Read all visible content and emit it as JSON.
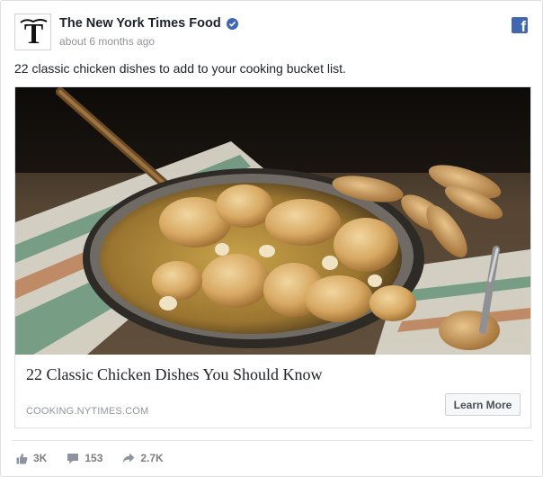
{
  "post": {
    "page_name": "The New York Times Food",
    "timestamp": "about 6 months ago",
    "text": "22 classic chicken dishes to add to your cooking bucket list."
  },
  "avatar": {
    "letter": "T"
  },
  "brand": {
    "fb_letter": "f",
    "accent": "#4267b2"
  },
  "link": {
    "title": "22 Classic Chicken Dishes You Should Know",
    "domain": "COOKING.NYTIMES.COM",
    "cta": "Learn More"
  },
  "stats": {
    "likes": "3K",
    "comments": "153",
    "shares": "2.7K"
  },
  "icons": [
    "verified-icon",
    "facebook-icon",
    "like-icon",
    "comment-icon",
    "share-icon"
  ]
}
